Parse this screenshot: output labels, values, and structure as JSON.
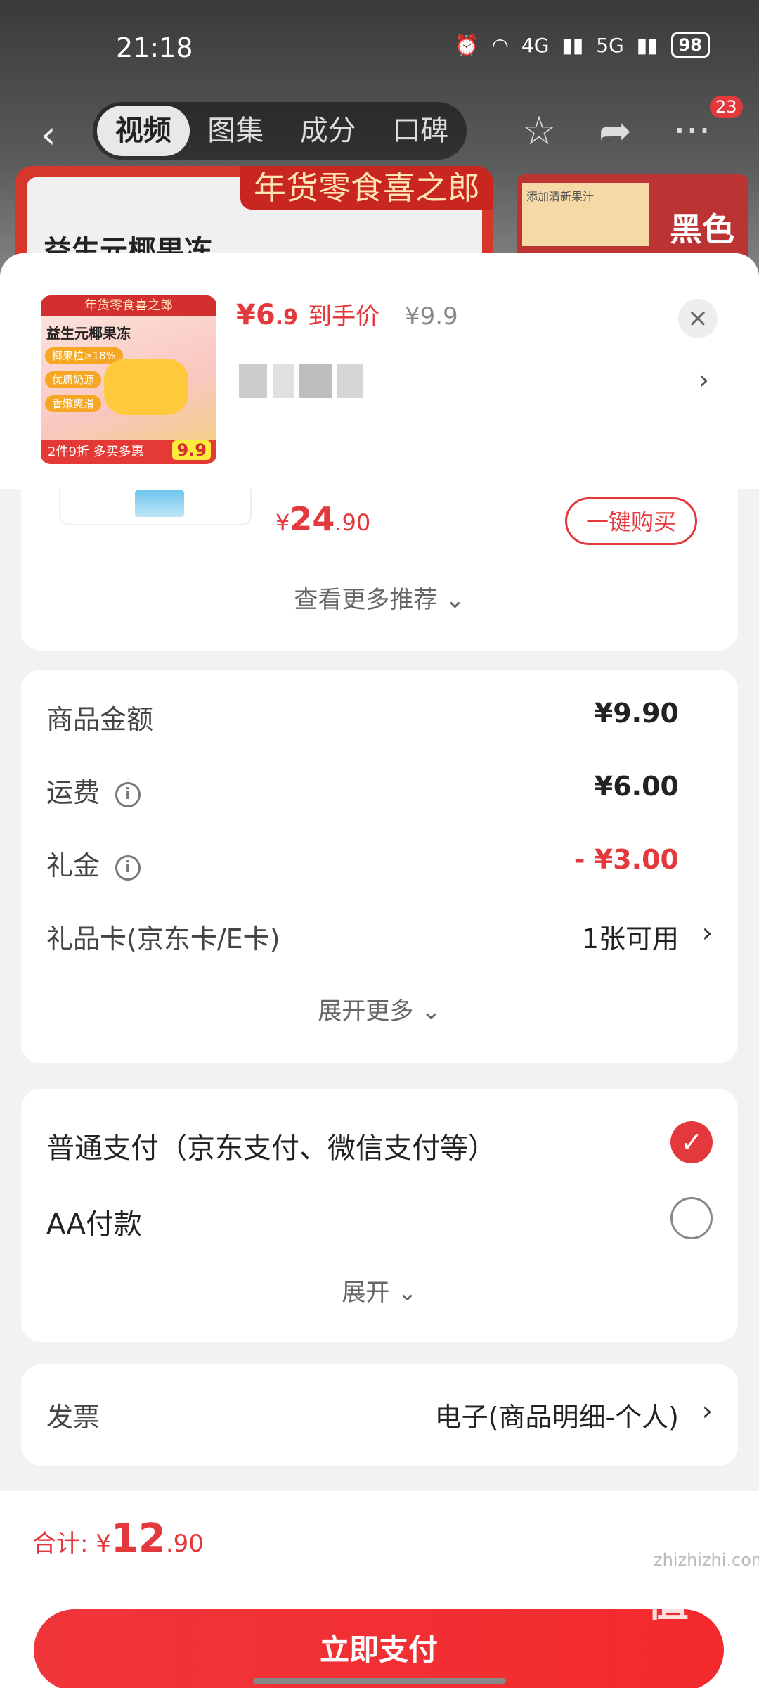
{
  "status_bar": {
    "time": "21:18",
    "net_4g": "4G",
    "net_5g": "5G",
    "battery": "98"
  },
  "nav": {
    "tabs": [
      "视频",
      "图集",
      "成分",
      "口碑"
    ],
    "active_tab": 0,
    "cart_badge": "23"
  },
  "background_banner": {
    "title": "年货零食喜之郎",
    "product_name": "益生元椰果冻",
    "note": "添加清新果汁",
    "side_text": "黑色"
  },
  "product": {
    "thumb_title": "年货零食喜之郎",
    "thumb_name": "益生元椰果冻",
    "thumb_chips": [
      "椰果粒≥18%",
      "优质奶源",
      "香嫩爽滑"
    ],
    "thumb_footer": "2件9折 多买多惠",
    "thumb_price": "9.9",
    "price_symbol": "¥",
    "price_int": "6",
    "price_dec": ".9",
    "price_label": "到手价",
    "original_price": "¥9.9"
  },
  "recommendation": {
    "price_symbol": "¥",
    "price_int": "24",
    "price_dec": ".90",
    "buy_label": "一键购买",
    "see_more": "查看更多推荐"
  },
  "summary": {
    "rows": [
      {
        "label": "商品金额",
        "value": "¥9.90"
      },
      {
        "label": "运费",
        "value": "¥6.00"
      },
      {
        "label": "礼金",
        "value": "- ¥3.00"
      },
      {
        "label": "礼品卡(京东卡/E卡)",
        "value": "1张可用"
      }
    ],
    "expand_more": "展开更多"
  },
  "payment": {
    "options": [
      {
        "label": "普通支付（京东支付、微信支付等）",
        "selected": true
      },
      {
        "label": "AA付款",
        "selected": false
      }
    ],
    "expand": "展开"
  },
  "invoice": {
    "label": "发票",
    "value": "电子(商品明细-个人)"
  },
  "footer": {
    "total_label": "合计:",
    "symbol": "¥",
    "total_int": "12",
    "total_dec": ".90",
    "pay_button": "立即支付"
  },
  "watermark": {
    "text": "值值值",
    "url": "zhizhizhi.com"
  },
  "colors": {
    "accent": "#e4393c",
    "background": "#f2f2f2"
  }
}
